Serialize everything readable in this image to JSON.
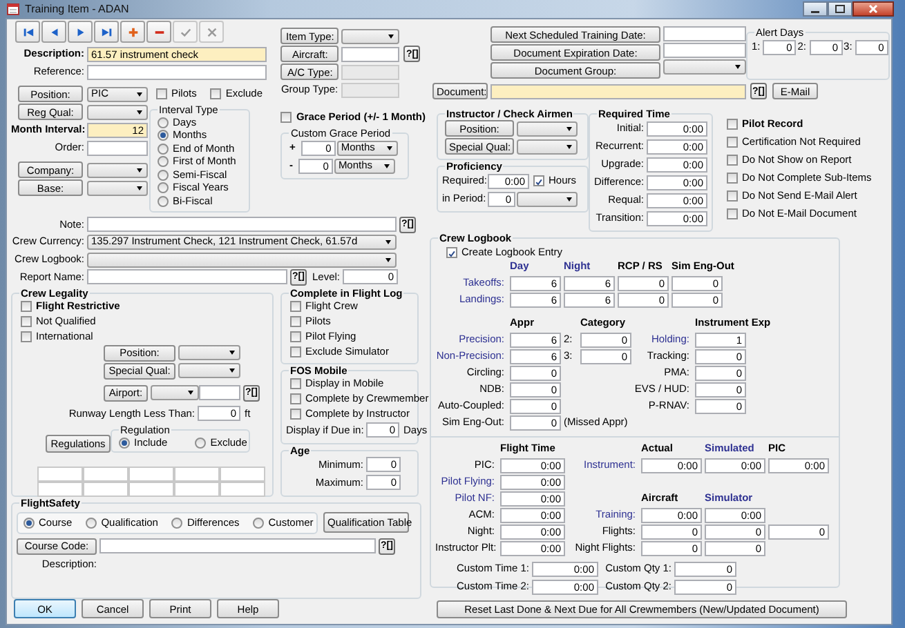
{
  "window": {
    "title": "Training Item - ADAN"
  },
  "toolbar": [
    {
      "kind": "first",
      "disabled": false
    },
    {
      "kind": "previous",
      "disabled": false
    },
    {
      "kind": "next",
      "disabled": false
    },
    {
      "kind": "last",
      "disabled": false
    },
    {
      "kind": "add",
      "disabled": false
    },
    {
      "kind": "delete",
      "disabled": false
    },
    {
      "kind": "save",
      "disabled": true
    },
    {
      "kind": "cancel",
      "disabled": true
    }
  ],
  "description": {
    "label": "Description:",
    "value": "61.57 instrument check"
  },
  "reference": {
    "label": "Reference:"
  },
  "position": {
    "button": "Position:",
    "value": "PIC"
  },
  "pilots": {
    "label": "Pilots",
    "checked": false
  },
  "exclude": {
    "label": "Exclude",
    "checked": false
  },
  "reg_qual": {
    "button": "Reg Qual:"
  },
  "month_interval": {
    "label": "Month Interval:",
    "value": "12"
  },
  "order": {
    "label": "Order:"
  },
  "company": {
    "button": "Company:"
  },
  "base": {
    "button": "Base:"
  },
  "interval_type": {
    "title": "Interval Type",
    "options": [
      {
        "label": "Days",
        "selected": false
      },
      {
        "label": "Months",
        "selected": true
      },
      {
        "label": "End of Month",
        "selected": false
      },
      {
        "label": "First of Month",
        "selected": false
      },
      {
        "label": "Semi-Fiscal",
        "selected": false
      },
      {
        "label": "Fiscal Years",
        "selected": false
      },
      {
        "label": "Bi-Fiscal",
        "selected": false
      }
    ]
  },
  "item_type": {
    "button": "Item Type:"
  },
  "aircraft": {
    "button": "Aircraft:",
    "lookup": "?[]"
  },
  "ac_type": {
    "button": "A/C Type:"
  },
  "group_type": {
    "label": "Group Type:"
  },
  "grace_period": {
    "label": "Grace Period (+/- 1 Month)",
    "checked": false
  },
  "custom_grace_period": {
    "title": "Custom Grace Period",
    "rows": [
      {
        "sign": "+",
        "value": "0",
        "unit": "Months"
      },
      {
        "sign": "-",
        "value": "0",
        "unit": "Months"
      }
    ]
  },
  "note": {
    "label": "Note:",
    "lookup": "?[]"
  },
  "crew_currency": {
    "label": "Crew Currency:",
    "value": "135.297 Instrument Check, 121 Instrument Check, 61.57d"
  },
  "crew_logbook_field": {
    "label": "Crew Logbook:"
  },
  "report_name": {
    "label": "Report Name:",
    "lookup": "?[]",
    "level_label": "Level:",
    "level_field": "0"
  },
  "crew_legality": {
    "title": "Crew Legality",
    "checks": [
      {
        "label": "Flight Restrictive",
        "checked": false,
        "bold": true
      },
      {
        "label": "Not Qualified",
        "checked": false,
        "bold": false
      },
      {
        "label": "International",
        "checked": false,
        "bold": false
      }
    ],
    "position": "Position:",
    "special_qual": "Special Qual:",
    "airport": "Airport:",
    "airport_lookup": "?[]",
    "runway_label": "Runway Length Less Than:",
    "runway_value": "0",
    "runway_unit": "ft",
    "regulations": "Regulations",
    "regulation": {
      "title": "Regulation",
      "options": [
        {
          "label": "Include",
          "selected": true
        },
        {
          "label": "Exclude",
          "selected": false
        }
      ]
    }
  },
  "complete_in_flight_log": {
    "title": "Complete in Flight Log",
    "items": [
      {
        "label": "Flight Crew",
        "checked": false
      },
      {
        "label": "Pilots",
        "checked": false
      },
      {
        "label": "Pilot Flying",
        "checked": false
      },
      {
        "label": "Exclude Simulator",
        "checked": false
      }
    ]
  },
  "fos_mobile": {
    "title": "FOS Mobile",
    "items": [
      {
        "label": "Display in Mobile",
        "checked": false
      },
      {
        "label": "Complete by Crewmember",
        "checked": false
      },
      {
        "label": "Complete by Instructor",
        "checked": false
      }
    ],
    "due_label": "Display if Due in:",
    "due_value": "0",
    "due_unit": "Days"
  },
  "age": {
    "title": "Age",
    "rows": [
      {
        "label": "Minimum:",
        "value": "0"
      },
      {
        "label": "Maximum:",
        "value": "0"
      }
    ]
  },
  "flightsafety": {
    "title": "FlightSafety",
    "options": [
      {
        "label": "Course",
        "selected": true
      },
      {
        "label": "Qualification",
        "selected": false
      },
      {
        "label": "Differences",
        "selected": false
      },
      {
        "label": "Customer",
        "selected": false
      }
    ],
    "qualification_table": "Qualification Table",
    "course_code": "Course Code:",
    "course_lookup": "?[]",
    "description_label": "Description:"
  },
  "bottom_buttons": [
    "OK",
    "Cancel",
    "Print",
    "Help"
  ],
  "next_training": {
    "button": "Next Scheduled Training Date:"
  },
  "doc_expiration": {
    "button": "Document Expiration Date:"
  },
  "doc_group": {
    "button": "Document Group:"
  },
  "alert_days": {
    "title": "Alert Days",
    "fields": [
      {
        "label": "1:",
        "value": "0"
      },
      {
        "label": "2:",
        "value": "0"
      },
      {
        "label": "3:",
        "value": "0"
      }
    ]
  },
  "document": {
    "button": "Document:",
    "lookup": "?[]",
    "email": "E-Mail"
  },
  "instructor": {
    "title": "Instructor / Check Airmen",
    "buttons": [
      "Position:",
      "Special Qual:"
    ]
  },
  "proficiency": {
    "title": "Proficiency",
    "required_label": "Required:",
    "required_value": "0:00",
    "hours": {
      "label": "Hours",
      "checked": true
    },
    "period_label": "in Period:",
    "period_value": "0"
  },
  "required_time": {
    "title": "Required Time",
    "rows": [
      {
        "label": "Initial:",
        "value": "0:00"
      },
      {
        "label": "Recurrent:",
        "value": "0:00"
      },
      {
        "label": "Upgrade:",
        "value": "0:00"
      },
      {
        "label": "Difference:",
        "value": "0:00"
      },
      {
        "label": "Requal:",
        "value": "0:00"
      },
      {
        "label": "Transition:",
        "value": "0:00"
      }
    ]
  },
  "pilot_record": [
    {
      "label": "Pilot Record",
      "checked": false,
      "bold": true
    },
    {
      "label": "Certification Not Required",
      "checked": false,
      "bold": false
    },
    {
      "label": "Do Not Show on Report",
      "checked": false,
      "bold": false
    },
    {
      "label": "Do Not Complete Sub-Items",
      "checked": false,
      "bold": false
    },
    {
      "label": "Do Not Send E-Mail Alert",
      "checked": false,
      "bold": false
    },
    {
      "label": "Do Not E-Mail Document",
      "checked": false,
      "bold": false
    }
  ],
  "crew_logbook": {
    "title": "Crew Logbook",
    "create": {
      "label": "Create Logbook Entry",
      "checked": true
    },
    "landing_columns": [
      {
        "label": "Day",
        "color": "#2e3192"
      },
      {
        "label": "Night",
        "color": "#2e3192"
      },
      {
        "label": "RCP / RS",
        "color": "#000000"
      },
      {
        "label": "Sim Eng-Out",
        "color": "#000000"
      }
    ],
    "landing_rows": [
      {
        "label": "Takeoffs:",
        "color": "#2e3192",
        "values": [
          "6",
          "6",
          "0",
          "0"
        ]
      },
      {
        "label": "Landings:",
        "color": "#2e3192",
        "values": [
          "6",
          "6",
          "0",
          "0"
        ]
      }
    ],
    "approach_headers": [
      "Appr",
      "Category",
      "Instrument Exp"
    ],
    "approaches": [
      {
        "label": "Precision:",
        "color": "#2e3192",
        "value": "6",
        "category_label": "2:",
        "category_value": "0"
      },
      {
        "label": "Non-Precision:",
        "color": "#2e3192",
        "value": "6",
        "category_label": "3:",
        "category_value": "0"
      },
      {
        "label": "Circling:",
        "color": "#000000",
        "value": "0"
      },
      {
        "label": "NDB:",
        "color": "#000000",
        "value": "0"
      },
      {
        "label": "Auto-Coupled:",
        "color": "#000000",
        "value": "0"
      },
      {
        "label": "Sim Eng-Out:",
        "color": "#000000",
        "value": "0",
        "note": "(Missed Appr)"
      }
    ],
    "instrument_exp": [
      {
        "label": "Holding:",
        "color": "#2e3192",
        "value": "1"
      },
      {
        "label": "Tracking:",
        "color": "#000000",
        "value": "0"
      },
      {
        "label": "PMA:",
        "color": "#000000",
        "value": "0"
      },
      {
        "label": "EVS / HUD:",
        "color": "#000000",
        "value": "0"
      },
      {
        "label": "P-RNAV:",
        "color": "#000000",
        "value": "0"
      }
    ],
    "flight_time_header": "Flight Time",
    "flight_time": [
      {
        "label": "PIC:",
        "color": "#000000",
        "value": "0:00"
      },
      {
        "label": "Pilot Flying:",
        "color": "#2e3192",
        "value": "0:00"
      },
      {
        "label": "Pilot NF:",
        "color": "#2e3192",
        "value": "0:00"
      },
      {
        "label": "ACM:",
        "color": "#000000",
        "value": "0:00"
      },
      {
        "label": "Night:",
        "color": "#000000",
        "value": "0:00"
      },
      {
        "label": "Instructor Plt:",
        "color": "#000000",
        "value": "0:00"
      }
    ],
    "instrument_columns": [
      {
        "label": "Actual",
        "color": "#000000"
      },
      {
        "label": "Simulated",
        "color": "#2e3192"
      },
      {
        "label": "PIC",
        "color": "#000000"
      }
    ],
    "instrument": {
      "label": "Instrument:",
      "color": "#2e3192",
      "values": [
        "0:00",
        "0:00",
        "0:00"
      ]
    },
    "aircraft_columns": [
      {
        "label": "Aircraft",
        "color": "#000000"
      },
      {
        "label": "Simulator",
        "color": "#2e3192"
      }
    ],
    "aircraft_rows": [
      {
        "label": "Training:",
        "color": "#2e3192",
        "values": [
          "0:00",
          "0:00"
        ]
      },
      {
        "label": "Flights:",
        "color": "#000000",
        "values": [
          "0",
          "0",
          "0"
        ]
      },
      {
        "label": "Night Flights:",
        "color": "#000000",
        "values": [
          "0",
          "0"
        ]
      }
    ],
    "custom": [
      {
        "label": "Custom Time 1:",
        "value": "0:00",
        "qty_label": "Custom Qty 1:",
        "qty_value": "0"
      },
      {
        "label": "Custom Time 2:",
        "value": "0:00",
        "qty_label": "Custom Qty 2:",
        "qty_value": "0"
      }
    ]
  },
  "reset_button": "Reset Last Done & Next Due for All Crewmembers (New/Updated Document)"
}
